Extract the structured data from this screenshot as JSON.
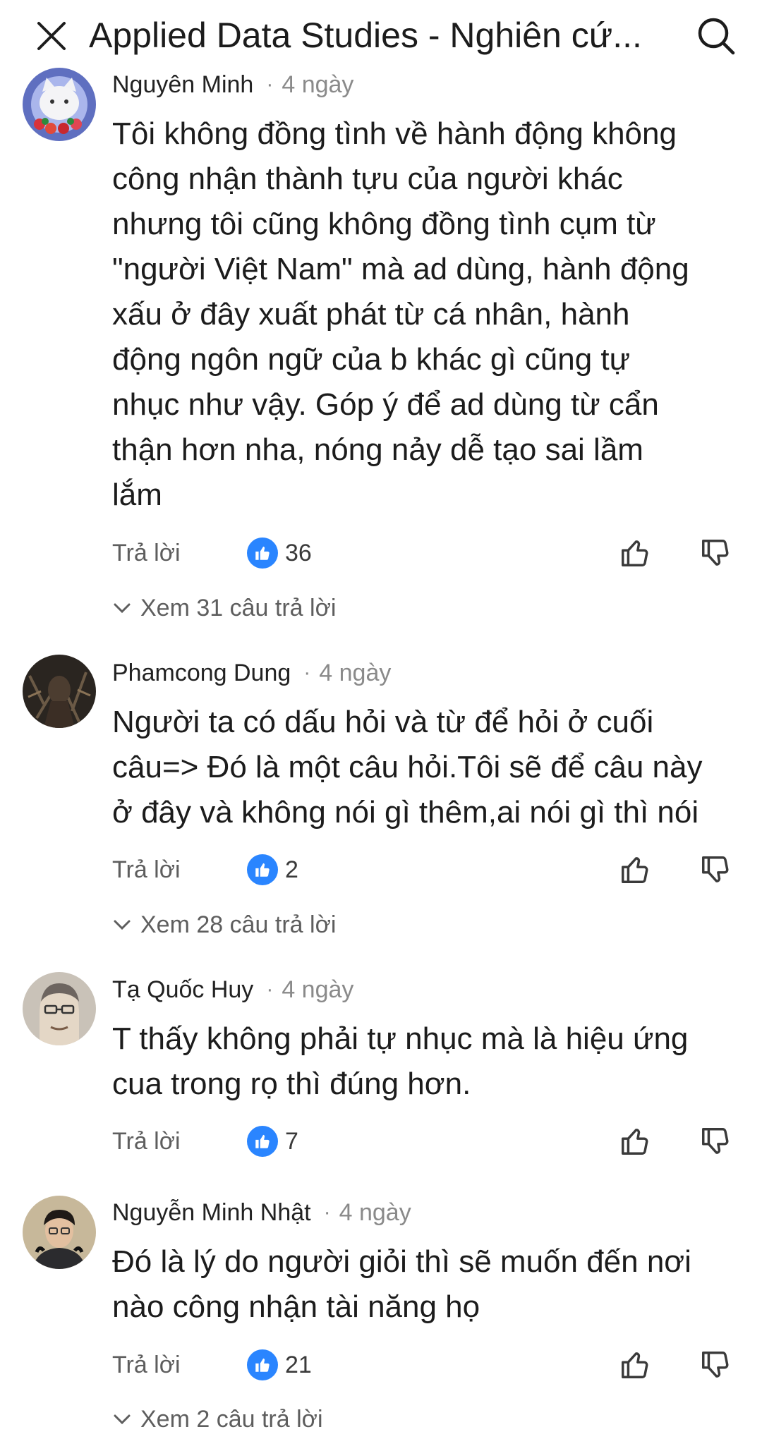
{
  "header": {
    "title": "Applied Data Studies - Nghiên cứ...",
    "close_icon": "close-icon",
    "search_icon": "search-icon"
  },
  "comments": [
    {
      "author": "Nguyên Minh",
      "time": "4 ngày",
      "lines": [
        "Tôi không đồng tình về hành động không",
        "công nhận thành tựu của người khác",
        "nhưng tôi cũng không đồng tình cụm từ",
        "\"người Việt Nam\" mà ad dùng, hành động",
        "xấu ở đây xuất phát từ cá nhân, hành",
        "động ngôn ngữ của b khác gì cũng tự",
        "nhục như vậy. Góp ý để ad dùng từ cẩn",
        "thận hơn nha, nóng nảy dễ tạo sai lầm",
        "lắm"
      ],
      "reply_label": "Trả lời",
      "likes": "36",
      "view_replies": "Xem 31 câu trả lời"
    },
    {
      "author": "Phamcong Dung",
      "time": "4 ngày",
      "lines": [
        "Người ta có dấu hỏi và từ để hỏi ở cuối",
        "câu=> Đó là một câu hỏi.Tôi sẽ để câu này",
        "ở đây và không nói gì thêm,ai nói gì thì nói"
      ],
      "reply_label": "Trả lời",
      "likes": "2",
      "view_replies": "Xem 28 câu trả lời"
    },
    {
      "author": "Tạ Quốc Huy",
      "time": "4 ngày",
      "lines": [
        "T thấy không phải tự nhục mà là hiệu ứng",
        "cua trong rọ thì đúng hơn."
      ],
      "reply_label": "Trả lời",
      "likes": "7"
    },
    {
      "author": "Nguyễn Minh Nhật",
      "time": "4 ngày",
      "lines": [
        "Đó là lý do người giỏi thì sẽ muốn đến nơi",
        "nào công nhận tài năng họ"
      ],
      "reply_label": "Trả lời",
      "likes": "21",
      "view_replies": "Xem 2 câu trả lời"
    }
  ],
  "colors": {
    "accent": "#2a85ff",
    "text": "#1c1c1c",
    "muted": "#8a8a8a"
  }
}
